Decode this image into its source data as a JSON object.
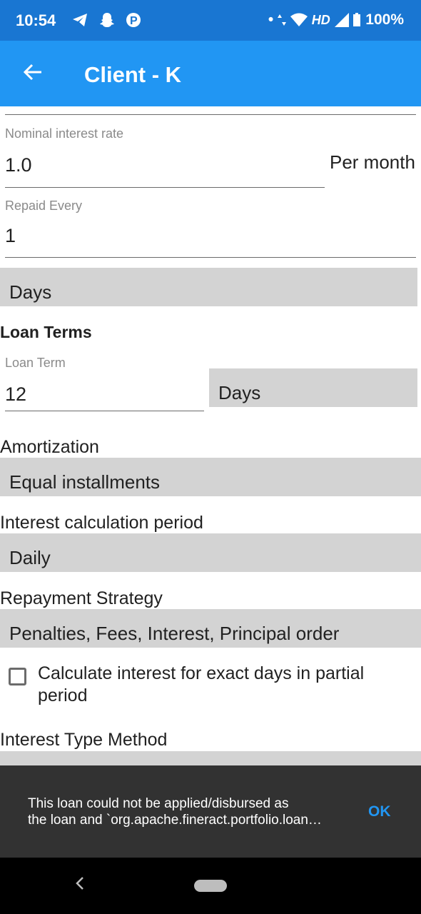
{
  "status_bar": {
    "time": "10:54",
    "left_icons": "telegram snapchat parking",
    "hd": "HD",
    "battery": "100%"
  },
  "app_bar": {
    "title": "Client - K"
  },
  "form": {
    "nominal_interest": {
      "label": "Nominal interest rate",
      "value": "1.0",
      "unit": "Per month"
    },
    "repaid_every": {
      "label": "Repaid Every",
      "value": "1"
    },
    "repaid_frequency": {
      "selected": "Days"
    },
    "loan_terms_heading": "Loan Terms",
    "loan_term": {
      "label": "Loan Term",
      "value": "12",
      "unit_selected": "Days"
    },
    "amortization": {
      "label": "Amortization",
      "selected": "Equal installments"
    },
    "interest_calc_period": {
      "label": "Interest calculation period",
      "selected": "Daily"
    },
    "repayment_strategy": {
      "label": "Repayment Strategy",
      "selected": "Penalties, Fees, Interest, Principal order"
    },
    "exact_days_checkbox": {
      "label": "Calculate interest for exact days in partial period",
      "checked": false
    },
    "interest_type_method": {
      "label": "Interest Type Method"
    }
  },
  "snackbar": {
    "line1": "This loan could not be applied/disbursed as",
    "line2": "the loan and `org.apache.fineract.portfolio.loan…",
    "action": "OK"
  },
  "colors": {
    "status_bar": "#1976d2",
    "app_bar": "#2196f3",
    "dropdown_bg": "#d3d3d3",
    "snackbar_bg": "#323232",
    "accent": "#2196f3"
  }
}
